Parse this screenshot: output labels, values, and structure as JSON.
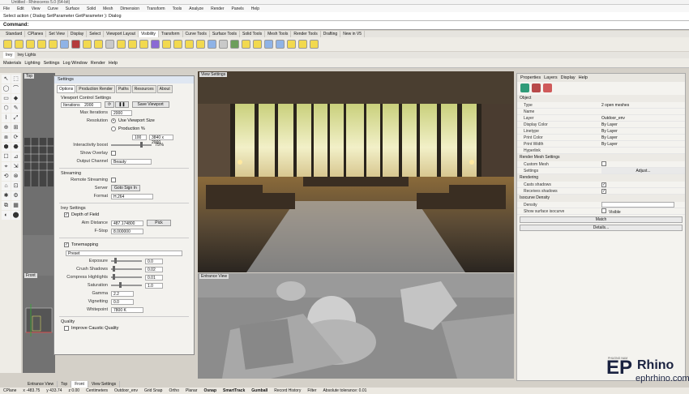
{
  "window": {
    "title": "Untitled - Rhinoceros 5.0 (64-bit)",
    "min": "–",
    "max": "□",
    "close": "✕"
  },
  "menu": [
    "File",
    "Edit",
    "View",
    "Curve",
    "Surface",
    "Solid",
    "Mesh",
    "Dimension",
    "Transform",
    "Tools",
    "Analyze",
    "Render",
    "Panels",
    "Help"
  ],
  "command": {
    "history": "Select action ( Dialog SetParameter GetParameter ): Dialog",
    "prompt": "Command:"
  },
  "toolbar_tabs": [
    "Standard",
    "CPlanes",
    "Set View",
    "Display",
    "Select",
    "Viewport Layout",
    "Visibility",
    "Transform",
    "Curve Tools",
    "Surface Tools",
    "Solid Tools",
    "Mesh Tools",
    "Render Tools",
    "Drafting",
    "New in V5"
  ],
  "toolbar_active": "Visibility",
  "icon_colors": [
    "#f2d94e",
    "#f2d94e",
    "#f2d94e",
    "#f2d94e",
    "#f2d94e",
    "#8fb3e6",
    "#b43c3c",
    "#f2d94e",
    "#f2d94e",
    "#c9c9c9",
    "#f2d94e",
    "#f2d94e",
    "#f2d94e",
    "#8a6ad4",
    "#f2d94e",
    "#f2d94e",
    "#f2d94e",
    "#f2d94e",
    "#8fb3e6",
    "#c9c9c9",
    "#6c9e5b",
    "#f2d94e",
    "#f2d94e",
    "#8fb3e6",
    "#8fb3e6",
    "#f2d94e",
    "#f2d94e",
    "#f2d94e"
  ],
  "sub_tabs": [
    "Irey",
    "Irey Lights"
  ],
  "lights_bar": [
    "Materials",
    "Lighting",
    "Settings",
    "Log Window",
    "Render",
    "Help"
  ],
  "left_tools": [
    "↖",
    "⬚",
    "◯",
    "⌒",
    "▭",
    "◆",
    "⬡",
    "✎",
    "⌇",
    "⤢",
    "⊕",
    "⊞",
    "⧈",
    "⟳",
    "⬢",
    "⬣",
    "☐",
    "⊿",
    "⌖",
    "⇲",
    "⟲",
    "⊗",
    "⌂",
    "⊡",
    "✱",
    "⚙",
    "⧉",
    "▦",
    "◐",
    "⬤"
  ],
  "left_viewport_labels": [
    "Top",
    "Front"
  ],
  "settings": {
    "title": "Settings",
    "tabs": [
      "Options",
      "Production Render",
      "Paths",
      "Resources",
      "About"
    ],
    "viewport_control": "Viewport Control Settings",
    "iterations_label": "Iterations",
    "iterations": "2000",
    "save_viewport": "Save Viewport",
    "max_iterations_label": "Max Iterations",
    "max_iterations": "2000",
    "resolution_label": "Resolution",
    "use_viewport_size": "Use Viewport Size",
    "production_pct": "Production %",
    "prod_pct_val": "100",
    "prod_size": "3840 x 2000",
    "interactivity_label": "Interactivity boost",
    "interactivity": "75%",
    "show_overlay": "Show Overlay",
    "output_channel_label": "Output Channel",
    "output_channel": "Beauty",
    "streaming": "Streaming",
    "remote_streaming": "Remote Streaming",
    "server_label": "Server",
    "server_btn": "Goto Sign In",
    "format_label": "Format",
    "format": "H.264",
    "irey_settings": "Irey Settings",
    "dof": "Depth of Field",
    "aim_distance_label": "Aim Distance",
    "aim_distance": "487.174800",
    "pick": "Pick",
    "fstop_label": "F-Stop",
    "fstop": "8.000000",
    "tonemapping": "Tonemapping",
    "preset": "Preset",
    "exposure_label": "Exposure",
    "exposure": "0.0",
    "crush_label": "Crush Shadows",
    "crush": "0.02",
    "compress_label": "Compress Highlights",
    "compress": "0.01",
    "saturation_label": "Saturation",
    "saturation": "1.0",
    "gamma_label": "Gamma",
    "gamma": "2.2",
    "vignetting_label": "Vignetting",
    "vignetting": "0.0",
    "whitepoint_label": "Whitepoint",
    "whitepoint": "7800 K",
    "quality": "Quality",
    "caustic": "Improve Caustic Quality"
  },
  "viewports": {
    "top_label": "View Settings",
    "bottom_label": "Entrance View"
  },
  "properties": {
    "tabs": [
      "Properties",
      "Layers",
      "Display",
      "Help"
    ],
    "object_section": "Object",
    "rows": [
      {
        "k": "Type",
        "v": "2 open meshes"
      },
      {
        "k": "Name",
        "v": ""
      },
      {
        "k": "Layer",
        "v": "Outdoor_env"
      },
      {
        "k": "Display Color",
        "v": "By Layer"
      },
      {
        "k": "Linetype",
        "v": "By Layer"
      },
      {
        "k": "Print Color",
        "v": "By Layer"
      },
      {
        "k": "Print Width",
        "v": "By Layer"
      },
      {
        "k": "Hyperlink",
        "v": ""
      }
    ],
    "render_mesh": "Render Mesh Settings",
    "custom_mesh": "Custom Mesh",
    "settings_label": "Settings",
    "adjust": "Adjust...",
    "rendering": "Rendering",
    "casts_shadows": "Casts shadows",
    "receives_shadows": "Receives shadows",
    "isocurve": "Isocurve Density",
    "density": "Density",
    "show_iso": "Show surface isocurve",
    "visible": "Visible",
    "match": "Match",
    "details": "Details..."
  },
  "bottom_tabs": [
    "Entrance View",
    "Top",
    "Front",
    "View Settings"
  ],
  "bottom_active": "Front",
  "status": [
    "CPlane",
    "x -483.75",
    "y 433.74",
    "z 0.00",
    "Centimeters",
    "Outdoor_env",
    "Grid Snap",
    "Ortho",
    "Planar",
    "Osnap",
    "SmartTrack",
    "Gumball",
    "Record History",
    "Filter",
    "Absolute tolerance: 0.01"
  ],
  "status_bold": [
    "Osnap",
    "SmartTrack",
    "Gumball"
  ],
  "watermark": {
    "brand": "Rhino",
    "url": "ephrhino.com",
    "mark": "EP",
    "small": "PHUONG NAM"
  }
}
